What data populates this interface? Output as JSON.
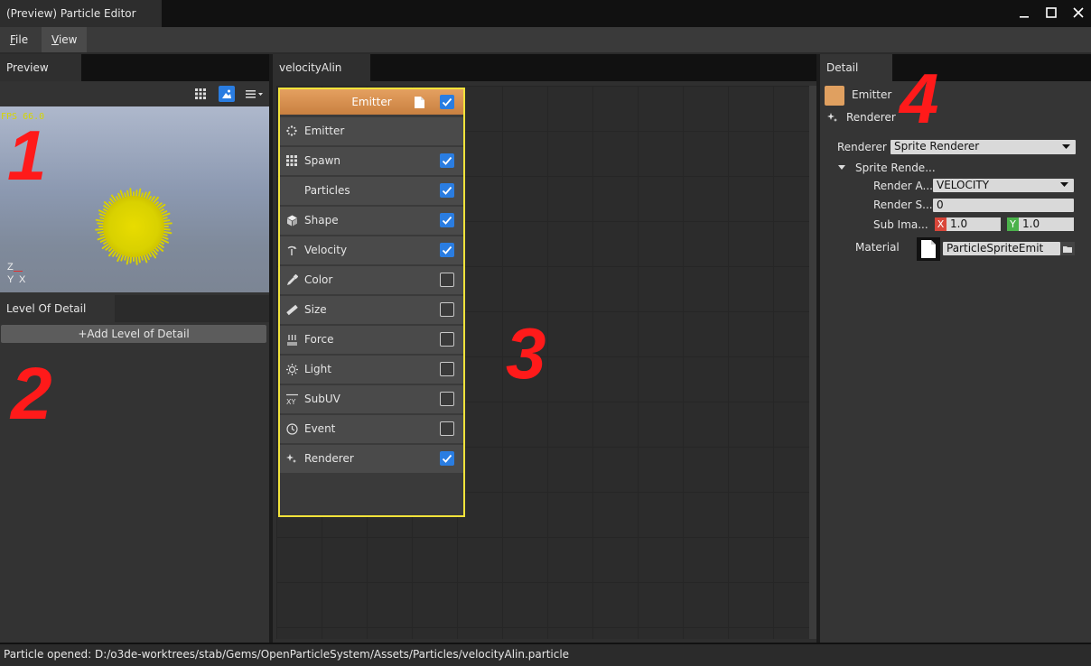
{
  "window": {
    "title": "(Preview) Particle Editor"
  },
  "menu": {
    "file_label": "F",
    "file_rest": "ile",
    "view_label": "V",
    "view_rest": "iew"
  },
  "preview": {
    "tab": "Preview",
    "fps": "FPS 66.0",
    "axis_z": "Z",
    "axis_y": "Y",
    "axis_x": "X",
    "icons": [
      "grid-icon",
      "landscape-icon",
      "menu-list-icon"
    ]
  },
  "lod": {
    "tab": "Level Of Detail",
    "add_button": "+Add Level of Detail"
  },
  "editor": {
    "tab": "velocityAlin",
    "node": {
      "header": "Emitter",
      "header_checked": true,
      "rows": [
        {
          "label": "Emitter",
          "icon": "emitter-icon",
          "has_checkbox": false,
          "checked": false
        },
        {
          "label": "Spawn",
          "icon": "spawn-grid-icon",
          "has_checkbox": true,
          "checked": true
        },
        {
          "label": "Particles",
          "icon": "",
          "has_checkbox": true,
          "checked": true
        },
        {
          "label": "Shape",
          "icon": "cube-icon",
          "has_checkbox": true,
          "checked": true
        },
        {
          "label": "Velocity",
          "icon": "velocity-icon",
          "has_checkbox": true,
          "checked": true
        },
        {
          "label": "Color",
          "icon": "eyedropper-icon",
          "has_checkbox": true,
          "checked": false
        },
        {
          "label": "Size",
          "icon": "ruler-icon",
          "has_checkbox": true,
          "checked": false
        },
        {
          "label": "Force",
          "icon": "force-icon",
          "has_checkbox": true,
          "checked": false
        },
        {
          "label": "Light",
          "icon": "sun-icon",
          "has_checkbox": true,
          "checked": false
        },
        {
          "label": "SubUV",
          "icon": "subuv-icon",
          "has_checkbox": true,
          "checked": false
        },
        {
          "label": "Event",
          "icon": "clock-icon",
          "has_checkbox": true,
          "checked": false
        },
        {
          "label": "Renderer",
          "icon": "sparkle-icon",
          "has_checkbox": true,
          "checked": true
        }
      ]
    }
  },
  "detail": {
    "tab": "Detail",
    "emitter_label": "Emitter",
    "renderer_label": "Renderer",
    "renderer_field_label": "Renderer",
    "renderer_value": "Sprite Renderer",
    "group_label": "Sprite Rende...",
    "render_alignment_label": "Render A...",
    "render_alignment_value": "VELOCITY",
    "render_sort_label": "Render S...",
    "render_sort_value": "0",
    "sub_image_label": "Sub Ima...",
    "sub_image_x_tag": "X",
    "sub_image_x": "1.0",
    "sub_image_y_tag": "Y",
    "sub_image_y": "1.0",
    "material_label": "Material",
    "material_value": "ParticleSpriteEmit",
    "emitter_color": "#e0a060"
  },
  "annotations": {
    "n1": "1",
    "n2": "2",
    "n3": "3",
    "n4": "4"
  },
  "status": {
    "text": "Particle opened: D:/o3de-worktrees/stab/Gems/OpenParticleSystem/Assets/Particles/velocityAlin.particle"
  },
  "colors": {
    "accent": "#2a7de1",
    "node_border": "#f2e33a",
    "annotation": "#ff1a1a",
    "fps": "#d6d600",
    "particle": "#d9d100"
  }
}
